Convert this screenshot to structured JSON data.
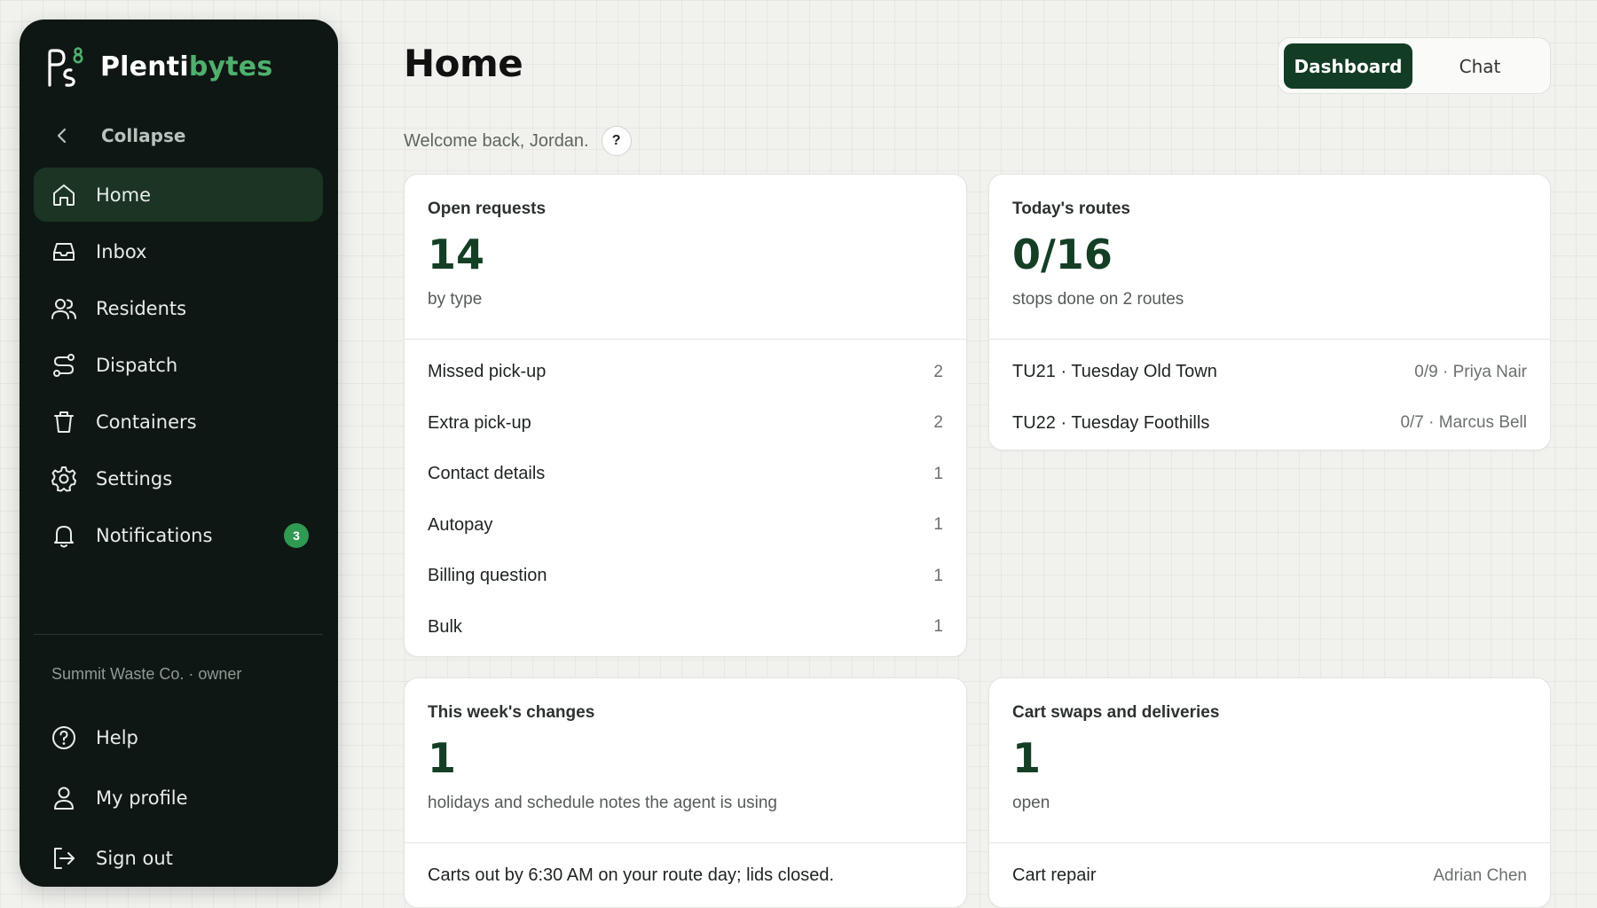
{
  "brand": {
    "name_part1": "Plenti",
    "name_part2": "bytes"
  },
  "sidebar": {
    "collapse_label": "Collapse",
    "items": [
      {
        "label": "Home",
        "icon": "home-icon",
        "active": true
      },
      {
        "label": "Inbox",
        "icon": "inbox-icon"
      },
      {
        "label": "Residents",
        "icon": "users-icon"
      },
      {
        "label": "Dispatch",
        "icon": "route-icon"
      },
      {
        "label": "Containers",
        "icon": "trash-bin-icon"
      },
      {
        "label": "Settings",
        "icon": "gear-icon"
      },
      {
        "label": "Notifications",
        "icon": "bell-icon",
        "badge": "3"
      }
    ],
    "org_line": "Summit Waste Co. · owner",
    "bottom_items": [
      {
        "label": "Help",
        "icon": "help-circle-icon"
      },
      {
        "label": "My profile",
        "icon": "user-icon"
      },
      {
        "label": "Sign out",
        "icon": "sign-out-icon"
      }
    ]
  },
  "header": {
    "title": "Home",
    "welcome": "Welcome back, Jordan.",
    "help_glyph": "?",
    "toggle": {
      "dashboard": "Dashboard",
      "chat": "Chat",
      "selected": "Dashboard"
    }
  },
  "cards": {
    "open_requests": {
      "label": "Open requests",
      "value": "14",
      "sub": "by type",
      "rows": [
        {
          "name": "Missed pick-up",
          "count": "2"
        },
        {
          "name": "Extra pick-up",
          "count": "2"
        },
        {
          "name": "Contact details",
          "count": "1"
        },
        {
          "name": "Autopay",
          "count": "1"
        },
        {
          "name": "Billing question",
          "count": "1"
        },
        {
          "name": "Bulk",
          "count": "1"
        }
      ]
    },
    "routes": {
      "label": "Today's routes",
      "value": "0/16",
      "sub": "stops done on 2 routes",
      "rows": [
        {
          "name": "TU21 · Tuesday Old Town",
          "detail": "0/9 · Priya Nair"
        },
        {
          "name": "TU22 · Tuesday Foothills",
          "detail": "0/7 · Marcus Bell"
        }
      ]
    },
    "changes": {
      "label": "This week's changes",
      "value": "1",
      "sub": "holidays and schedule notes the agent is using",
      "rows": [
        {
          "name": "Carts out by 6:30 AM on your route day; lids closed."
        }
      ]
    },
    "swaps": {
      "label": "Cart swaps and deliveries",
      "value": "1",
      "sub": "open",
      "rows": [
        {
          "name": "Cart repair",
          "detail": "Adrian Chen"
        }
      ]
    }
  },
  "colors": {
    "sidebar_bg": "#0f1714",
    "accent": "#133c24",
    "brand_green": "#4fb06d",
    "badge": "#2f9a52"
  }
}
